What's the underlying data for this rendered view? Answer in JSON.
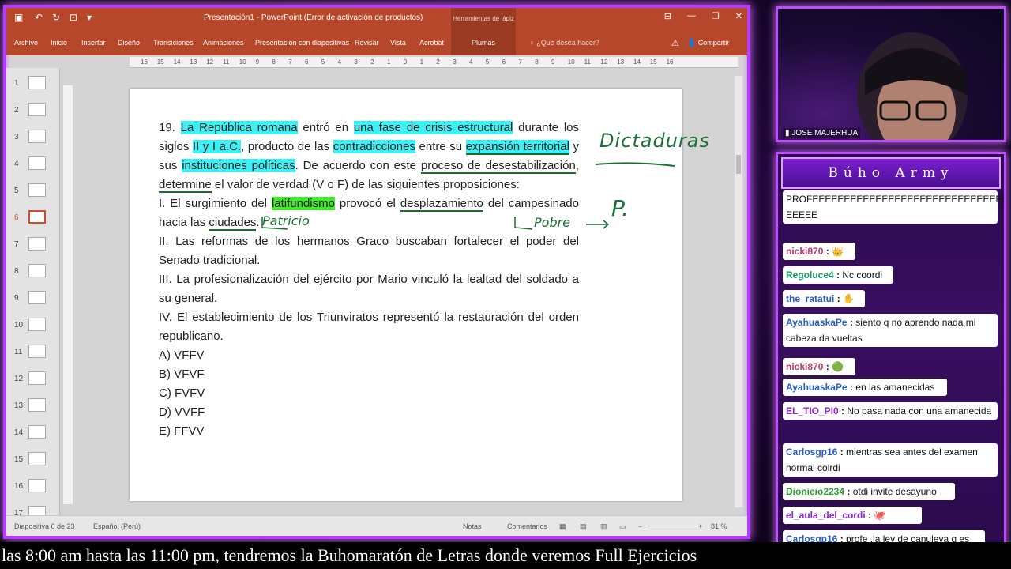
{
  "window": {
    "title": "Presentación1 - PowerPoint (Error de activación de productos)",
    "context_group": "Herramientas de lápiz"
  },
  "ribbon": {
    "tabs": [
      "Archivo",
      "Inicio",
      "Insertar",
      "Diseño",
      "Transiciones",
      "Animaciones",
      "Presentación con diapositivas",
      "Revisar",
      "Vista",
      "Acrobat"
    ],
    "context_tab": "Plumas",
    "tell_me": "¿Qué desea hacer?",
    "share": "Compartir"
  },
  "ruler_labels": [
    "16",
    "15",
    "14",
    "13",
    "12",
    "11",
    "10",
    "9",
    "8",
    "7",
    "6",
    "5",
    "4",
    "3",
    "2",
    "1",
    "0",
    "1",
    "2",
    "3",
    "4",
    "5",
    "6",
    "7",
    "8",
    "9",
    "10",
    "11",
    "12",
    "13",
    "14",
    "15",
    "16"
  ],
  "thumbnails": [
    "1",
    "2",
    "3",
    "4",
    "5",
    "6",
    "7",
    "8",
    "9",
    "10",
    "11",
    "12",
    "13",
    "14",
    "15",
    "16",
    "17"
  ],
  "active_thumbnail": "6",
  "slide": {
    "q_num": "19. ",
    "q_p1": "La República romana",
    "q_p2": " entró en ",
    "q_p3": "una fase de crisis estructural",
    "q_p4": " durante los siglos ",
    "q_p5": "II y I a.C.",
    "q_p6": ", producto de las ",
    "q_p7": "contradicciones",
    "q_p8": " entre su ",
    "q_p9": "expansión territorial",
    "q_p10": " y sus ",
    "q_p11": "instituciones políticas",
    "q_p12": ". De acuerdo con este ",
    "q_p13": "proceso de desestabilización",
    "q_p14": ", ",
    "q_p15": "determine",
    "q_p16": " el valor de verdad (V o F) de las siguientes proposiciones:",
    "s1_a": "I. El surgimiento del ",
    "s1_b": "latifundismo",
    "s1_c": " provocó el ",
    "s1_d": "desplazamiento",
    "s1_e": " del campesinado hacia las ",
    "s1_f": "ciudades",
    "s1_g": ".",
    "s2": "II. Las reformas de los hermanos Graco buscaban fortalecer el poder del Senado tradicional.",
    "s3": "III. La profesionalización del ejército por Mario vinculó la lealtad del soldado a su general.",
    "s4": "IV. El establecimiento de los Triunviratos representó la restauración del orden republicano.",
    "options": [
      "A) VFFV",
      "B) VFVF",
      "C) FVFV",
      "D) VVFF",
      "E) FFVV"
    ],
    "ink": {
      "dictaduras": "Dictaduras",
      "patricio": "Patricio",
      "pobre": "Pobre",
      "p": "P."
    }
  },
  "statusbar": {
    "slide_count": "Diapositiva 6 de 23",
    "language": "Español (Perú)",
    "notes": "Notas",
    "comments": "Comentarios",
    "zoom": "81 %"
  },
  "webcam": {
    "name": "JOSE MAJERHUA"
  },
  "chat": {
    "title": "Búho Army",
    "messages": [
      {
        "user": "",
        "sep": "",
        "text": "PROFEEEEEEEEEEEEEEEEEEEEEEEEEEEEEEEEEEEEEE EEEEE"
      },
      {
        "user": "nicki870",
        "sep": " : ",
        "text": "👑"
      },
      {
        "user": "Regoluce4",
        "sep": " : ",
        "text": "Nc coordi"
      },
      {
        "user": "the_ratatui",
        "sep": " : ",
        "text": "✋"
      },
      {
        "user": "AyahuaskaPe",
        "sep": " : ",
        "text": "siento q no aprendo nada mi cabeza da vueltas"
      },
      {
        "user": "nicki870",
        "sep": " : ",
        "text": "🟢"
      },
      {
        "user": "AyahuaskaPe",
        "sep": " : ",
        "text": "en las amanecidas"
      },
      {
        "user": "EL_TIO_PI0",
        "sep": " : ",
        "text": "No pasa nada con una amanecida"
      },
      {
        "user": "Carlosgp16",
        "sep": " : ",
        "text": "mientras sea antes del examen normal colrdi"
      },
      {
        "user": "Dionicio2234",
        "sep": " : ",
        "text": "otdi invite desayuno"
      },
      {
        "user": "el_aula_del_cordi",
        "sep": " : ",
        "text": "🐙"
      },
      {
        "user": "Carlosgp16",
        "sep": " : ",
        "text": "profe ,la ley de canuleya q es"
      }
    ],
    "user_colors": {
      "nicki870": "#c03a6a",
      "Regoluce4": "#1a9a6a",
      "the_ratatui": "#2a5fc0",
      "AyahuaskaPe": "#2a5fc0",
      "EL_TIO_PI0": "#8a2ad0",
      "Carlosgp16": "#2a5fc0",
      "Dionicio2234": "#2aa02a",
      "el_aula_del_cordi": "#8a2ad0"
    }
  },
  "ticker": "las 8:00 am hasta las 11:00 pm, tendremos la Buhomaratón de Letras donde veremos Full Ejercicios"
}
